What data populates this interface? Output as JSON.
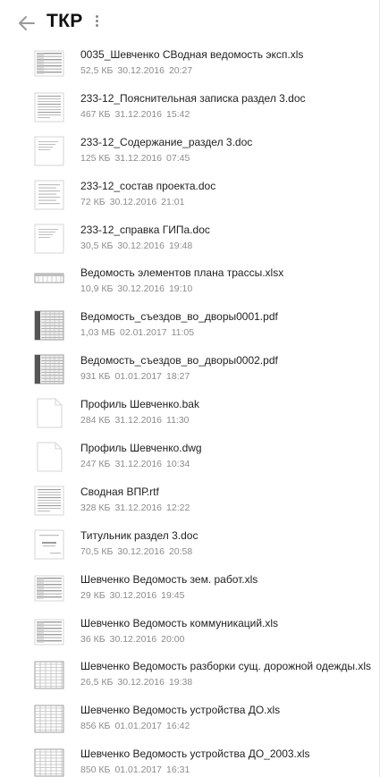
{
  "header": {
    "title": "ТКР",
    "back_icon": "arrow-left-icon",
    "more_icon": "more-vertical-icon"
  },
  "files": [
    {
      "name": "0035_Шевченко СВодная ведомость эксп.xls",
      "size": "52,5 КБ",
      "date": "30.12.2016",
      "time": "20:27",
      "thumb": "spreadsheet-dense"
    },
    {
      "name": "233-12_Пояснительная записка раздел 3.doc",
      "size": "467 КБ",
      "date": "31.12.2016",
      "time": "15:42",
      "thumb": "text-page"
    },
    {
      "name": "233-12_Содержание_раздел 3.doc",
      "size": "125 КБ",
      "date": "31.12.2016",
      "time": "07:45",
      "thumb": "text-sparse"
    },
    {
      "name": "233-12_состав проекта.doc",
      "size": "72 КБ",
      "date": "30.12.2016",
      "time": "21:01",
      "thumb": "text-list"
    },
    {
      "name": "233-12_справка ГИПа.doc",
      "size": "30,5 КБ",
      "date": "30.12.2016",
      "time": "19:48",
      "thumb": "text-sparse"
    },
    {
      "name": "Ведомость элементов плана трассы.xlsx",
      "size": "10,9 КБ",
      "date": "30.12.2016",
      "time": "19:10",
      "thumb": "spreadsheet-band"
    },
    {
      "name": "Ведомость_съездов_во_дворы0001.pdf",
      "size": "1,03 МБ",
      "date": "02.01.2017",
      "time": "11:05",
      "thumb": "scan-table"
    },
    {
      "name": "Ведомость_съездов_во_дворы0002.pdf",
      "size": "931 КБ",
      "date": "01.01.2017",
      "time": "18:27",
      "thumb": "scan-table"
    },
    {
      "name": "Профиль Шевченко.bak",
      "size": "284 КБ",
      "date": "31.12.2016",
      "time": "11:30",
      "thumb": "blank-file"
    },
    {
      "name": "Профиль Шевченко.dwg",
      "size": "247 КБ",
      "date": "31.12.2016",
      "time": "10:34",
      "thumb": "blank-file"
    },
    {
      "name": "Сводная ВПР.rtf",
      "size": "328 КБ",
      "date": "31.12.2016",
      "time": "12:22",
      "thumb": "text-page"
    },
    {
      "name": "Титульник раздел 3.doc",
      "size": "70,5 КБ",
      "date": "30.12.2016",
      "time": "20:58",
      "thumb": "title-page"
    },
    {
      "name": "Шевченко Ведомость зем. работ.xls",
      "size": "29 КБ",
      "date": "30.12.2016",
      "time": "19:45",
      "thumb": "spreadsheet-dense"
    },
    {
      "name": "Шевченко Ведомость коммуникаций.xls",
      "size": "36 КБ",
      "date": "30.12.2016",
      "time": "20:00",
      "thumb": "spreadsheet-dense"
    },
    {
      "name": "Шевченко Ведомость разборки сущ. дорожной одежды.xls",
      "size": "26,5 КБ",
      "date": "30.12.2016",
      "time": "19:38",
      "thumb": "spreadsheet-grid"
    },
    {
      "name": "Шевченко Ведомость устройства ДО.xls",
      "size": "856 КБ",
      "date": "01.01.2017",
      "time": "16:42",
      "thumb": "spreadsheet-grid"
    },
    {
      "name": "Шевченко Ведомость устройства ДО_2003.xls",
      "size": "850 КБ",
      "date": "01.01.2017",
      "time": "16:31",
      "thumb": "spreadsheet-grid"
    }
  ]
}
